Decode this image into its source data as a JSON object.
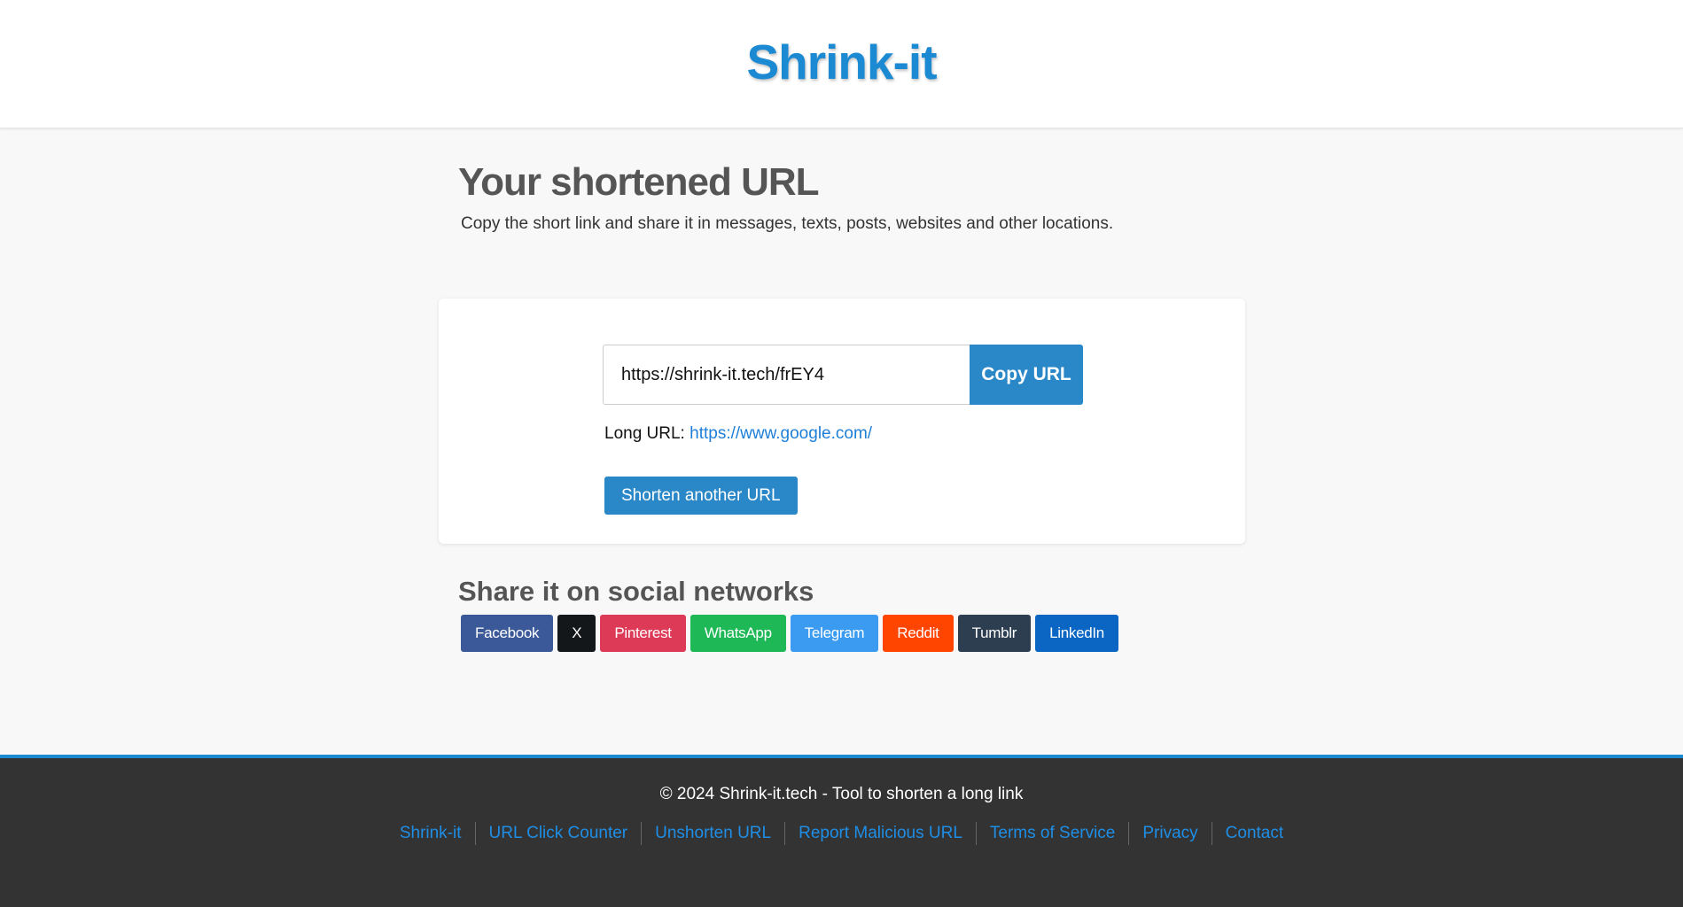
{
  "header": {
    "logo_text": "Shrink-it"
  },
  "main": {
    "title": "Your shortened URL",
    "subtitle": "Copy the short link and share it in messages, texts, posts, websites and other locations."
  },
  "result": {
    "short_url": "https://shrink-it.tech/frEY4",
    "copy_label": "Copy URL",
    "long_url_label": "Long URL:",
    "long_url": "https://www.google.com/",
    "shorten_another_label": "Shorten another URL"
  },
  "share": {
    "title": "Share it on social networks",
    "buttons": [
      {
        "label": "Facebook",
        "color": "#3b5998"
      },
      {
        "label": "X",
        "color": "#14171a"
      },
      {
        "label": "Pinterest",
        "color": "#dc3a56"
      },
      {
        "label": "WhatsApp",
        "color": "#1fb856"
      },
      {
        "label": "Telegram",
        "color": "#3a9bf0"
      },
      {
        "label": "Reddit",
        "color": "#ff4500"
      },
      {
        "label": "Tumblr",
        "color": "#2c3e50"
      },
      {
        "label": "LinkedIn",
        "color": "#0a66c2"
      }
    ]
  },
  "footer": {
    "copyright": "© 2024 Shrink-it.tech - Tool to shorten a long link",
    "links": [
      "Shrink-it",
      "URL Click Counter",
      "Unshorten URL",
      "Report Malicious URL",
      "Terms of Service",
      "Privacy",
      "Contact"
    ]
  },
  "colors": {
    "accent": "#1b8ad3",
    "button": "#2b88c8",
    "link": "#1e7fd8",
    "footer_bg": "#333333"
  }
}
